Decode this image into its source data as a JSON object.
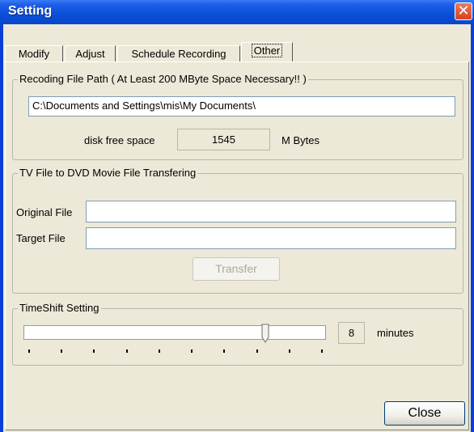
{
  "window": {
    "title": "Setting",
    "close_glyph": "✕"
  },
  "tabs": [
    {
      "label": "Modify"
    },
    {
      "label": "Adjust"
    },
    {
      "label": "Schedule Recording"
    },
    {
      "label": "Other",
      "active": true
    }
  ],
  "recording": {
    "group_label": "Recoding File Path ( At Least 200 MByte Space Necessary!! )",
    "path_value": "C:\\Documents and Settings\\mis\\My Documents\\",
    "free_space_label": "disk free space",
    "free_space_value": "1545",
    "free_space_unit": "M Bytes"
  },
  "transfer": {
    "group_label": "TV File to DVD Movie File Transfering",
    "original_label": "Original File",
    "original_value": "",
    "target_label": "Target File",
    "target_value": "",
    "button_label": "Transfer",
    "button_enabled": false
  },
  "timeshift": {
    "group_label": "TimeShift Setting",
    "slider_level": 0.8,
    "value": "8",
    "unit": "minutes",
    "tick_count": 10
  },
  "footer": {
    "close_label": "Close"
  },
  "colors": {
    "titlebar": "#0a4fd8",
    "dialog_face": "#ece9d8",
    "close_red": "#d4421f"
  },
  "icons": {
    "close": "close-x-icon",
    "slider_thumb": "slider-thumb-icon"
  }
}
